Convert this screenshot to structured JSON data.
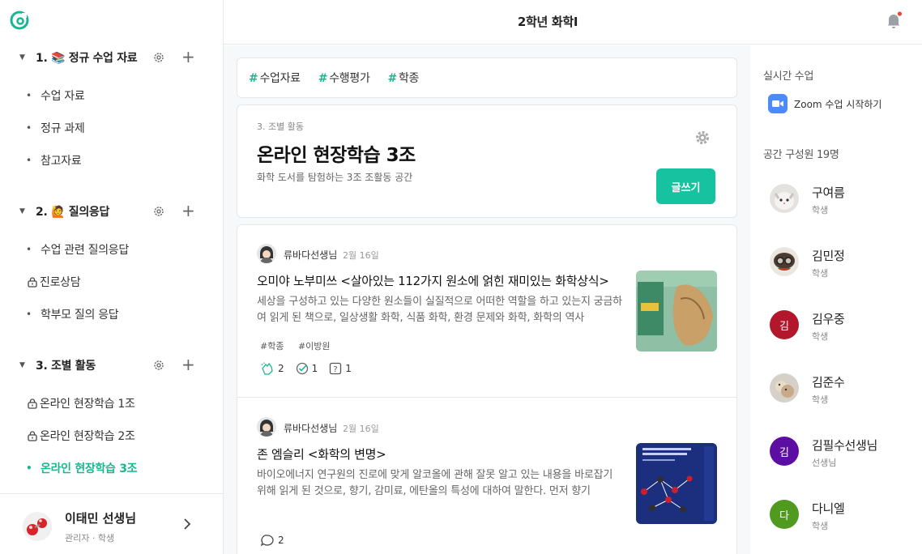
{
  "app": {
    "logo_icon": "class-logo-icon",
    "accent": "#17b890"
  },
  "header": {
    "title": "2학년 화학I",
    "bell_icon": "bell-icon"
  },
  "sidebar": {
    "sections": [
      {
        "title": "1. 📚 정규 수업 자료",
        "items": [
          "수업 자료",
          "정규 과제",
          "참고자료"
        ]
      },
      {
        "title": "2. 🙋 질의응답",
        "items": [
          "수업 관련 질의응답",
          "진로상담",
          "학부모 질의 응답"
        ]
      },
      {
        "title": "3. 조별 활동",
        "items": [
          "온라인 현장학습 1조",
          "온라인 현장학습 2조",
          "온라인 현장학습 3조"
        ]
      }
    ],
    "profile": {
      "name": "이태민 선생님",
      "role": "관리자 · 학생"
    }
  },
  "main": {
    "tags": [
      "수업자료",
      "수행평가",
      "학종"
    ],
    "space": {
      "crumb": "3. 조별 활동",
      "title": "온라인 현장학습 3조",
      "desc": "화학 도서를 탐험하는 3조 조활동 공간",
      "write_label": "글쓰기"
    },
    "posts": [
      {
        "author": "류바다선생님",
        "date": "2월 16일",
        "title": "오미야 노부미쓰 <살아있는 112가지 원소에 얽힌 재미있는 화학상식>",
        "body": "세상을 구성하고 있는 다양한 원소들이 실질적으로 어떠한 역할을 하고 있는지 궁금하여 읽게 된 책으로, 일상생활 화학, 식품 화학, 환경 문제와 화학, 화학의 역사",
        "tags": [
          "#학종",
          "#이방원"
        ],
        "clap": "2",
        "check": "1",
        "question": "1"
      },
      {
        "author": "류바다선생님",
        "date": "2월 16일",
        "title": "존 엠슬리 <화학의 변명>",
        "body": "바이오에너지 연구원의 진로에 맞게 알코올에 관해 잘못 알고 있는 내용을 바로잡기 위해 읽게 된 것으로, 향기, 감미료, 에탄올의 특성에 대하여 말한다. 먼저 향기",
        "comments": "2"
      }
    ]
  },
  "right": {
    "live_label": "실시간 수업",
    "zoom_label": "Zoom 수업 시작하기",
    "members_label": "공간 구성원 19명",
    "members": [
      {
        "name": "구여름",
        "role": "학생",
        "initial": "",
        "color": "#dcdcdc"
      },
      {
        "name": "김민정",
        "role": "학생",
        "initial": "",
        "color": "#d9c9b6"
      },
      {
        "name": "김우중",
        "role": "학생",
        "initial": "김",
        "color": "#b3172b"
      },
      {
        "name": "김준수",
        "role": "학생",
        "initial": "",
        "color": "#cfc7bd"
      },
      {
        "name": "김필수선생님",
        "role": "선생님",
        "initial": "김",
        "color": "#5b0ea1"
      },
      {
        "name": "다니엘",
        "role": "학생",
        "initial": "다",
        "color": "#4f9a1f"
      }
    ]
  }
}
